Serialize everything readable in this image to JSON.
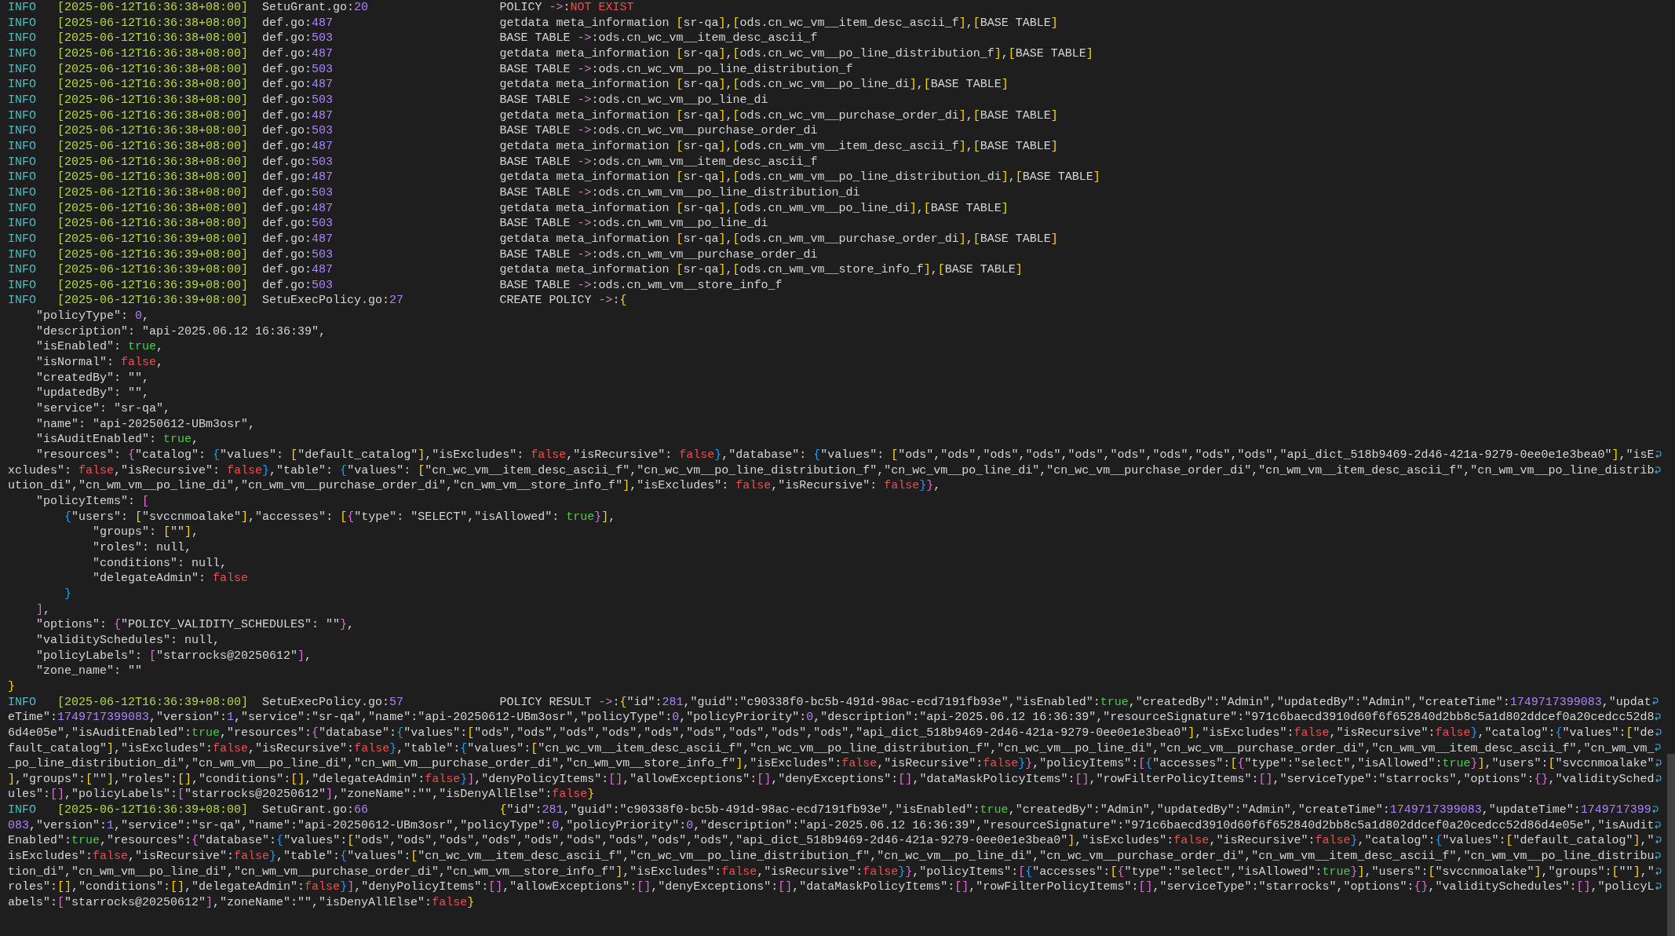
{
  "log_entries": [
    {
      "level": "INFO",
      "timestamp": "[2025-06-12T16:36:38+08:00]",
      "source": "SetuGrant.go:20",
      "message": "POLICY ->:",
      "alert": "NOT EXIST",
      "wrapped": false
    },
    {
      "level": "INFO",
      "timestamp": "[2025-06-12T16:36:38+08:00]",
      "source": "def.go:487",
      "message": "getdata meta_information [sr-qa],[ods.cn_wc_vm__item_desc_ascii_f],[BASE TABLE]",
      "wrapped": false
    },
    {
      "level": "INFO",
      "timestamp": "[2025-06-12T16:36:38+08:00]",
      "source": "def.go:503",
      "message": "BASE TABLE ->:ods.cn_wc_vm__item_desc_ascii_f",
      "wrapped": false
    },
    {
      "level": "INFO",
      "timestamp": "[2025-06-12T16:36:38+08:00]",
      "source": "def.go:487",
      "message": "getdata meta_information [sr-qa],[ods.cn_wc_vm__po_line_distribution_f],[BASE TABLE]",
      "wrapped": false
    },
    {
      "level": "INFO",
      "timestamp": "[2025-06-12T16:36:38+08:00]",
      "source": "def.go:503",
      "message": "BASE TABLE ->:ods.cn_wc_vm__po_line_distribution_f",
      "wrapped": false
    },
    {
      "level": "INFO",
      "timestamp": "[2025-06-12T16:36:38+08:00]",
      "source": "def.go:487",
      "message": "getdata meta_information [sr-qa],[ods.cn_wc_vm__po_line_di],[BASE TABLE]",
      "wrapped": false
    },
    {
      "level": "INFO",
      "timestamp": "[2025-06-12T16:36:38+08:00]",
      "source": "def.go:503",
      "message": "BASE TABLE ->:ods.cn_wc_vm__po_line_di",
      "wrapped": false
    },
    {
      "level": "INFO",
      "timestamp": "[2025-06-12T16:36:38+08:00]",
      "source": "def.go:487",
      "message": "getdata meta_information [sr-qa],[ods.cn_wc_vm__purchase_order_di],[BASE TABLE]",
      "wrapped": false
    },
    {
      "level": "INFO",
      "timestamp": "[2025-06-12T16:36:38+08:00]",
      "source": "def.go:503",
      "message": "BASE TABLE ->:ods.cn_wc_vm__purchase_order_di",
      "wrapped": false
    },
    {
      "level": "INFO",
      "timestamp": "[2025-06-12T16:36:38+08:00]",
      "source": "def.go:487",
      "message": "getdata meta_information [sr-qa],[ods.cn_wm_vm__item_desc_ascii_f],[BASE TABLE]",
      "wrapped": false
    },
    {
      "level": "INFO",
      "timestamp": "[2025-06-12T16:36:38+08:00]",
      "source": "def.go:503",
      "message": "BASE TABLE ->:ods.cn_wm_vm__item_desc_ascii_f",
      "wrapped": false
    },
    {
      "level": "INFO",
      "timestamp": "[2025-06-12T16:36:38+08:00]",
      "source": "def.go:487",
      "message": "getdata meta_information [sr-qa],[ods.cn_wm_vm__po_line_distribution_di],[BASE TABLE]",
      "wrapped": false
    },
    {
      "level": "INFO",
      "timestamp": "[2025-06-12T16:36:38+08:00]",
      "source": "def.go:503",
      "message": "BASE TABLE ->:ods.cn_wm_vm__po_line_distribution_di",
      "wrapped": false
    },
    {
      "level": "INFO",
      "timestamp": "[2025-06-12T16:36:38+08:00]",
      "source": "def.go:487",
      "message": "getdata meta_information [sr-qa],[ods.cn_wm_vm__po_line_di],[BASE TABLE]",
      "wrapped": false
    },
    {
      "level": "INFO",
      "timestamp": "[2025-06-12T16:36:38+08:00]",
      "source": "def.go:503",
      "message": "BASE TABLE ->:ods.cn_wm_vm__po_line_di",
      "wrapped": false
    },
    {
      "level": "INFO",
      "timestamp": "[2025-06-12T16:36:39+08:00]",
      "source": "def.go:487",
      "message": "getdata meta_information [sr-qa],[ods.cn_wm_vm__purchase_order_di],[BASE TABLE]",
      "wrapped": false
    },
    {
      "level": "INFO",
      "timestamp": "[2025-06-12T16:36:39+08:00]",
      "source": "def.go:503",
      "message": "BASE TABLE ->:ods.cn_wm_vm__purchase_order_di",
      "wrapped": false
    },
    {
      "level": "INFO",
      "timestamp": "[2025-06-12T16:36:39+08:00]",
      "source": "def.go:487",
      "message": "getdata meta_information [sr-qa],[ods.cn_wm_vm__store_info_f],[BASE TABLE]",
      "wrapped": false
    },
    {
      "level": "INFO",
      "timestamp": "[2025-06-12T16:36:39+08:00]",
      "source": "def.go:503",
      "message": "BASE TABLE ->:ods.cn_wm_vm__store_info_f",
      "wrapped": false
    },
    {
      "level": "INFO",
      "timestamp": "[2025-06-12T16:36:39+08:00]",
      "source": "SetuExecPolicy.go:27",
      "message": "CREATE POLICY ->:{",
      "wrapped": false,
      "continuation": [
        {
          "text": "    \"policyType\": 0,",
          "wrapped": false
        },
        {
          "text": "    \"description\": \"api-2025.06.12 16:36:39\",",
          "wrapped": false
        },
        {
          "text": "    \"isEnabled\": true,",
          "wrapped": false
        },
        {
          "text": "    \"isNormal\": false,",
          "wrapped": false
        },
        {
          "text": "    \"createdBy\": \"\",",
          "wrapped": false
        },
        {
          "text": "    \"updatedBy\": \"\",",
          "wrapped": false
        },
        {
          "text": "    \"service\": \"sr-qa\",",
          "wrapped": false
        },
        {
          "text": "    \"name\": \"api-20250612-UBm3osr\",",
          "wrapped": false
        },
        {
          "text": "    \"isAuditEnabled\": true,",
          "wrapped": false
        },
        {
          "text": "    \"resources\": {\"catalog\": {\"values\": [\"default_catalog\"],\"isExcludes\": false,\"isRecursive\": false},\"database\": {\"values\": [\"ods\",\"ods\",\"ods\",\"ods\",\"ods\",\"ods\",\"ods\",\"ods\",\"ods\",\"api_dict_518b9469-2d46-421a-9279-0ee0e1e3bea0\"],\"isE",
          "wrapped": true
        },
        {
          "text": "xcludes\": false,\"isRecursive\": false},\"table\": {\"values\": [\"cn_wc_vm__item_desc_ascii_f\",\"cn_wc_vm__po_line_distribution_f\",\"cn_wc_vm__po_line_di\",\"cn_wc_vm__purchase_order_di\",\"cn_wm_vm__item_desc_ascii_f\",\"cn_wm_vm__po_line_distrib",
          "wrapped": true
        },
        {
          "text": "ution_di\",\"cn_wm_vm__po_line_di\",\"cn_wm_vm__purchase_order_di\",\"cn_wm_vm__store_info_f\"],\"isExcludes\": false,\"isRecursive\": false}},",
          "wrapped": false
        },
        {
          "text": "    \"policyItems\": [",
          "wrapped": false
        },
        {
          "text": "        {\"users\": [\"svccnmoalake\"],\"accesses\": [{\"type\": \"SELECT\",\"isAllowed\": true}],",
          "wrapped": false
        },
        {
          "text": "            \"groups\": [\"\"],",
          "wrapped": false
        },
        {
          "text": "            \"roles\": null,",
          "wrapped": false
        },
        {
          "text": "            \"conditions\": null,",
          "wrapped": false
        },
        {
          "text": "            \"delegateAdmin\": false",
          "wrapped": false
        },
        {
          "text": "        }",
          "wrapped": false
        },
        {
          "text": "    ],",
          "wrapped": false
        },
        {
          "text": "    \"options\": {\"POLICY_VALIDITY_SCHEDULES\": \"\"},",
          "wrapped": false
        },
        {
          "text": "    \"validitySchedules\": null,",
          "wrapped": false
        },
        {
          "text": "    \"policyLabels\": [\"starrocks@20250612\"],",
          "wrapped": false
        },
        {
          "text": "    \"zone_name\": \"\"",
          "wrapped": false
        },
        {
          "text": "}",
          "wrapped": false
        }
      ]
    },
    {
      "level": "INFO",
      "timestamp": "[2025-06-12T16:36:39+08:00]",
      "source": "SetuExecPolicy.go:57",
      "message": "POLICY RESULT ->:{\"id\":281,\"guid\":\"c90338f0-bc5b-491d-98ac-ecd7191fb93e\",\"isEnabled\":true,\"createdBy\":\"Admin\",\"updatedBy\":\"Admin\",\"createTime\":1749717399083,\"updat",
      "wrapped": true,
      "continuation": [
        {
          "text": "eTime\":1749717399083,\"version\":1,\"service\":\"sr-qa\",\"name\":\"api-20250612-UBm3osr\",\"policyType\":0,\"policyPriority\":0,\"description\":\"api-2025.06.12 16:36:39\",\"resourceSignature\":\"971c6baecd3910d60f6f652840d2bb8c5a1d802ddcef0a20cedcc52d8",
          "wrapped": true
        },
        {
          "text": "6d4e05e\",\"isAuditEnabled\":true,\"resources\":{\"database\":{\"values\":[\"ods\",\"ods\",\"ods\",\"ods\",\"ods\",\"ods\",\"ods\",\"ods\",\"ods\",\"api_dict_518b9469-2d46-421a-9279-0ee0e1e3bea0\"],\"isExcludes\":false,\"isRecursive\":false},\"catalog\":{\"values\":[\"de",
          "wrapped": true
        },
        {
          "text": "fault_catalog\"],\"isExcludes\":false,\"isRecursive\":false},\"table\":{\"values\":[\"cn_wc_vm__item_desc_ascii_f\",\"cn_wc_vm__po_line_distribution_f\",\"cn_wc_vm__po_line_di\",\"cn_wc_vm__purchase_order_di\",\"cn_wm_vm__item_desc_ascii_f\",\"cn_wm_vm_",
          "wrapped": true
        },
        {
          "text": "_po_line_distribution_di\",\"cn_wm_vm__po_line_di\",\"cn_wm_vm__purchase_order_di\",\"cn_wm_vm__store_info_f\"],\"isExcludes\":false,\"isRecursive\":false}},\"policyItems\":[{\"accesses\":[{\"type\":\"select\",\"isAllowed\":true}],\"users\":[\"svccnmoalake\"",
          "wrapped": true
        },
        {
          "text": "],\"groups\":[\"\"],\"roles\":[],\"conditions\":[],\"delegateAdmin\":false}],\"denyPolicyItems\":[],\"allowExceptions\":[],\"denyExceptions\":[],\"dataMaskPolicyItems\":[],\"rowFilterPolicyItems\":[],\"serviceType\":\"starrocks\",\"options\":{},\"validitySched",
          "wrapped": true
        },
        {
          "text": "ules\":[],\"policyLabels\":[\"starrocks@20250612\"],\"zoneName\":\"\",\"isDenyAllElse\":false}",
          "wrapped": false
        }
      ]
    },
    {
      "level": "INFO",
      "timestamp": "[2025-06-12T16:36:39+08:00]",
      "source": "SetuGrant.go:66",
      "message": "{\"id\":281,\"guid\":\"c90338f0-bc5b-491d-98ac-ecd7191fb93e\",\"isEnabled\":true,\"createdBy\":\"Admin\",\"updatedBy\":\"Admin\",\"createTime\":1749717399083,\"updateTime\":1749717399",
      "wrapped": true,
      "continuation": [
        {
          "text": "083,\"version\":1,\"service\":\"sr-qa\",\"name\":\"api-20250612-UBm3osr\",\"policyType\":0,\"policyPriority\":0,\"description\":\"api-2025.06.12 16:36:39\",\"resourceSignature\":\"971c6baecd3910d60f6f652840d2bb8c5a1d802ddcef0a20cedcc52d86d4e05e\",\"isAudit",
          "wrapped": true
        },
        {
          "text": "Enabled\":true,\"resources\":{\"database\":{\"values\":[\"ods\",\"ods\",\"ods\",\"ods\",\"ods\",\"ods\",\"ods\",\"ods\",\"ods\",\"api_dict_518b9469-2d46-421a-9279-0ee0e1e3bea0\"],\"isExcludes\":false,\"isRecursive\":false},\"catalog\":{\"values\":[\"default_catalog\"],\"",
          "wrapped": true
        },
        {
          "text": "isExcludes\":false,\"isRecursive\":false},\"table\":{\"values\":[\"cn_wc_vm__item_desc_ascii_f\",\"cn_wc_vm__po_line_distribution_f\",\"cn_wc_vm__po_line_di\",\"cn_wc_vm__purchase_order_di\",\"cn_wm_vm__item_desc_ascii_f\",\"cn_wm_vm__po_line_distribu",
          "wrapped": true
        },
        {
          "text": "tion_di\",\"cn_wm_vm__po_line_di\",\"cn_wm_vm__purchase_order_di\",\"cn_wm_vm__store_info_f\"],\"isExcludes\":false,\"isRecursive\":false}},\"policyItems\":[{\"accesses\":[{\"type\":\"select\",\"isAllowed\":true}],\"users\":[\"svccnmoalake\"],\"groups\":[\"\"],\"",
          "wrapped": true
        },
        {
          "text": "roles\":[],\"conditions\":[],\"delegateAdmin\":false}],\"denyPolicyItems\":[],\"allowExceptions\":[],\"denyExceptions\":[],\"dataMaskPolicyItems\":[],\"rowFilterPolicyItems\":[],\"serviceType\":\"starrocks\",\"options\":{},\"validitySchedules\":[],\"policyL",
          "wrapped": true
        },
        {
          "text": "abels\":[\"starrocks@20250612\"],\"zoneName\":\"\",\"isDenyAllElse\":false}",
          "wrapped": false
        }
      ]
    }
  ]
}
